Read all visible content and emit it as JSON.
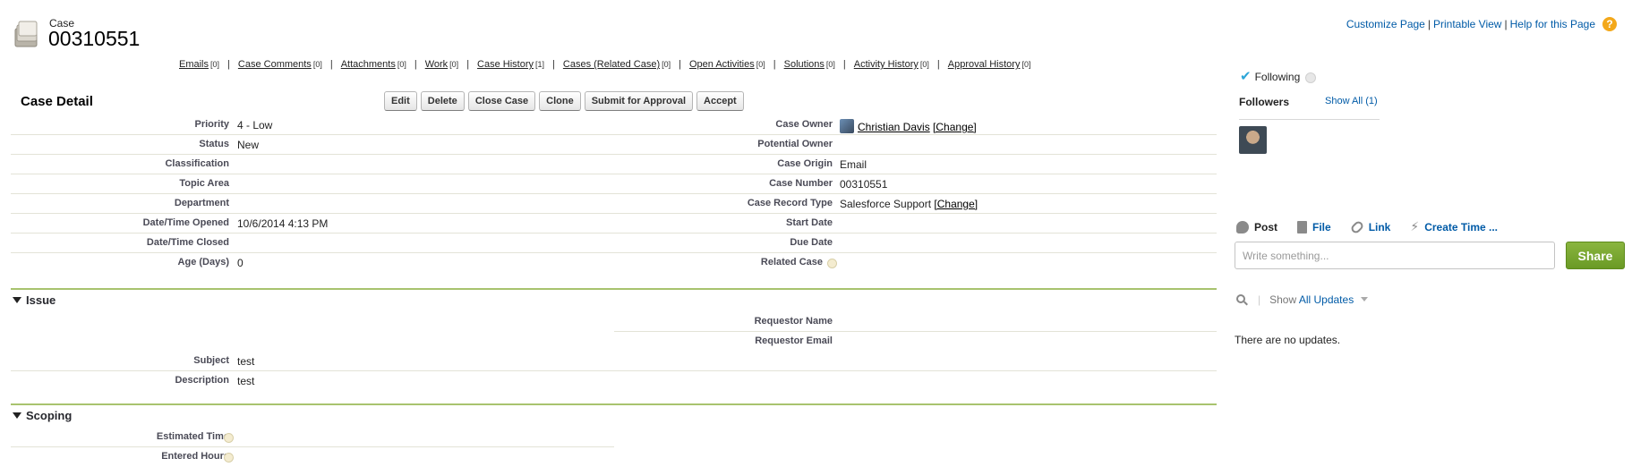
{
  "header": {
    "object_type": "Case",
    "record_number": "00310551",
    "links": [
      "Customize Page",
      "Printable View",
      "Help for this Page"
    ],
    "separator": "|",
    "help_icon": "?"
  },
  "related_links": [
    {
      "label": "Emails",
      "count": "[0]"
    },
    {
      "label": "Case Comments",
      "count": "[0]"
    },
    {
      "label": "Attachments",
      "count": "[0]"
    },
    {
      "label": "Work",
      "count": "[0]"
    },
    {
      "label": "Case History",
      "count": "[1]"
    },
    {
      "label": "Cases (Related Case)",
      "count": "[0]"
    },
    {
      "label": "Open Activities",
      "count": "[0]"
    },
    {
      "label": "Solutions",
      "count": "[0]"
    },
    {
      "label": "Activity History",
      "count": "[0]"
    },
    {
      "label": "Approval History",
      "count": "[0]"
    }
  ],
  "detail": {
    "title": "Case Detail",
    "buttons": [
      "Edit",
      "Delete",
      "Close Case",
      "Clone",
      "Submit for Approval",
      "Accept"
    ],
    "rows": [
      {
        "l1": "Priority",
        "v1": "4 - Low",
        "l2": "Case Owner",
        "v2": "Christian Davis",
        "v2_extra": "[Change]"
      },
      {
        "l1": "Status",
        "v1": "New",
        "l2": "Potential Owner",
        "v2": ""
      },
      {
        "l1": "Classification",
        "v1": "",
        "l2": "Case Origin",
        "v2": "Email"
      },
      {
        "l1": "Topic Area",
        "v1": "",
        "l2": "Case Number",
        "v2": "00310551"
      },
      {
        "l1": "Department",
        "v1": "",
        "l2": "Case Record Type",
        "v2": "Salesforce Support",
        "v2_extra": "[Change]"
      },
      {
        "l1": "Date/Time Opened",
        "v1": "10/6/2014 4:13 PM",
        "l2": "Start Date",
        "v2": ""
      },
      {
        "l1": "Date/Time Closed",
        "v1": "",
        "l2": "Due Date",
        "v2": ""
      },
      {
        "l1": "Age (Days)",
        "v1": "0",
        "l2": "Related Case",
        "v2": ""
      }
    ]
  },
  "issue": {
    "title": "Issue",
    "right_rows": [
      {
        "label": "Requestor Name",
        "value": ""
      },
      {
        "label": "Requestor Email",
        "value": ""
      }
    ],
    "rows": [
      {
        "label": "Subject",
        "value": "test"
      },
      {
        "label": "Description",
        "value": "test"
      }
    ]
  },
  "scoping": {
    "title": "Scoping",
    "rows": [
      {
        "label": "Estimated Time",
        "value": ""
      },
      {
        "label": "Entered Hours",
        "value": ""
      }
    ]
  },
  "chatter": {
    "following": "Following",
    "followers_label": "Followers",
    "show_all": "Show All (1)",
    "tabs": [
      "Post",
      "File",
      "Link",
      "Create Time ..."
    ],
    "post_placeholder": "Write something...",
    "share": "Share",
    "show_label": "Show",
    "filter_value": "All Updates",
    "no_updates": "There are no updates."
  },
  "colors": {
    "link": "#015ba7",
    "section_line": "#a8c36e",
    "share_button": "#7aa532",
    "following_check": "#2da6d8"
  }
}
